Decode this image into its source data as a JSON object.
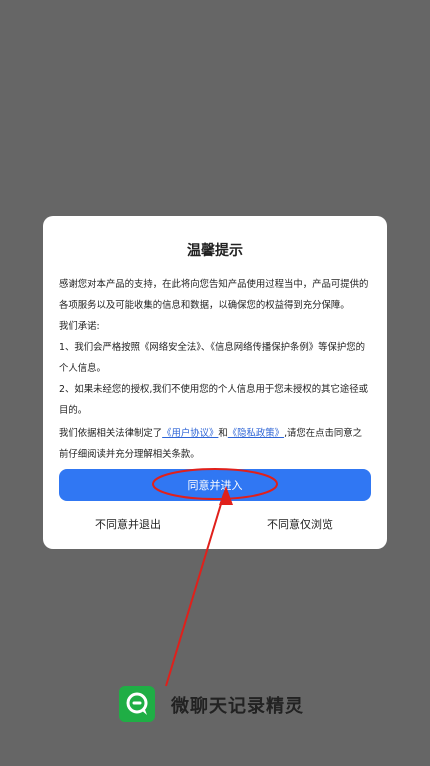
{
  "dialog": {
    "title": "温馨提示",
    "paragraph1": "感谢您对本产品的支持，在此将向您告知产品使用过程当中，产品可提供的各项服务以及可能收集的信息和数据，以确保您的权益得到充分保障。",
    "promise_heading": "我们承诺:",
    "promise1": "1、我们会严格按照《网络安全法》、《信息网络传播保护条例》等保护您的个人信息。",
    "promise2": "2、如果未经您的授权,我们不使用您的个人信息用于您未授权的其它途径或目的。",
    "policy_prefix": "我们依据相关法律制定了",
    "user_agreement_link": "《用户协议》",
    "policy_and": "和",
    "privacy_policy_link": "《隐私政策》",
    "policy_suffix": ",请您在点击同意之前仔细阅读并充分理解相关条款。",
    "agree_button": "同意并进入",
    "disagree_exit_button": "不同意并退出",
    "disagree_browse_button": "不同意仅浏览"
  },
  "brand": {
    "name": "微聊天记录精灵",
    "logo_icon": "chat-bubble-icon"
  },
  "colors": {
    "overlay": "#666666",
    "accent": "#3077f3",
    "link": "#2d64d6",
    "annotation": "#e0201b",
    "brand_green": "#1fae45"
  }
}
